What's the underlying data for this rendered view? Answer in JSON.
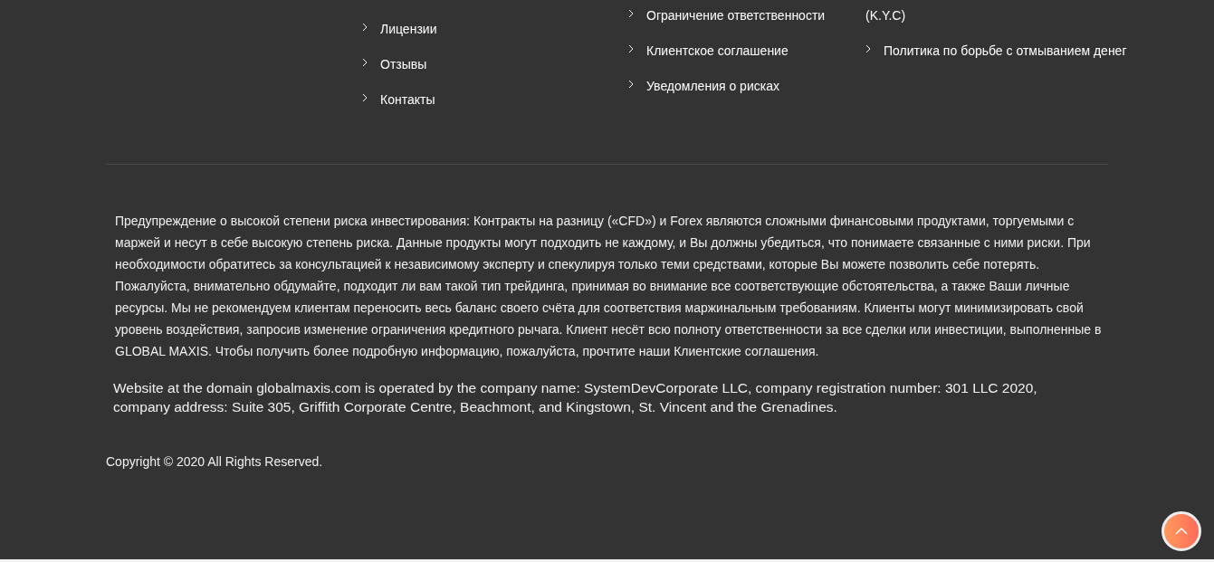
{
  "footer_columns": [
    {
      "items": [
        {
          "kind": "link",
          "label": "Лицензии"
        },
        {
          "kind": "link",
          "label": "Отзывы"
        },
        {
          "kind": "link",
          "label": "Контакты"
        }
      ]
    },
    {
      "items": [
        {
          "kind": "link",
          "label": "Ограничение ответственности"
        },
        {
          "kind": "link",
          "label": "Клиентское соглашение"
        },
        {
          "kind": "link",
          "label": "Уведомления о рисках"
        }
      ]
    },
    {
      "items": [
        {
          "kind": "continuation",
          "label": "(K.Y.C)"
        },
        {
          "kind": "link",
          "label": "Политика по борьбе с отмыванием денег"
        }
      ]
    }
  ],
  "risk_warning": "Предупреждение о высокой степени риска инвестирования: Контракты на разницу («CFD») и Forex являются сложными финансовыми продуктами, торгуемыми с маржей и несут в себе высокую степень риска. Данные продукты могут подходить не каждому, и Вы должны убедиться, что понимаете связанные с ними риски. При необходимости обратитесь за консультацией к независимому эксперту и спекулируя только теми средствами, которые Вы можете позволить себе потерять. Пожалуйста, внимательно обдумайте, подходит ли вам такой тип трейдинга, принимая во внимание все соответствующие обстоятельства, а также Ваши личные ресурсы. Мы не рекомендуем клиентам переносить весь баланс своего счёта для соответствия маржинальным требованиям. Клиенты могут минимизировать свой уровень воздействия, запросив изменение ограничения кредитного рычага. Клиент несёт всю полноту ответственности за все сделки или инвестиции, выполненные в GLOBAL MAXIS. Чтобы получить более подробную информацию, пожалуйста, прочтите наши Клиентские соглашения.",
  "company_info": "Website at the domain globalmaxis.com is operated by the company name: SystemDevCorporate LLC, company registration number: 301 LLC 2020, company address: Suite 305, Griffith Corporate Centre, Beachmont, and Kingstown, St. Vincent and the Grenadines.",
  "copyright": "Copyright © 2020 All Rights Reserved."
}
